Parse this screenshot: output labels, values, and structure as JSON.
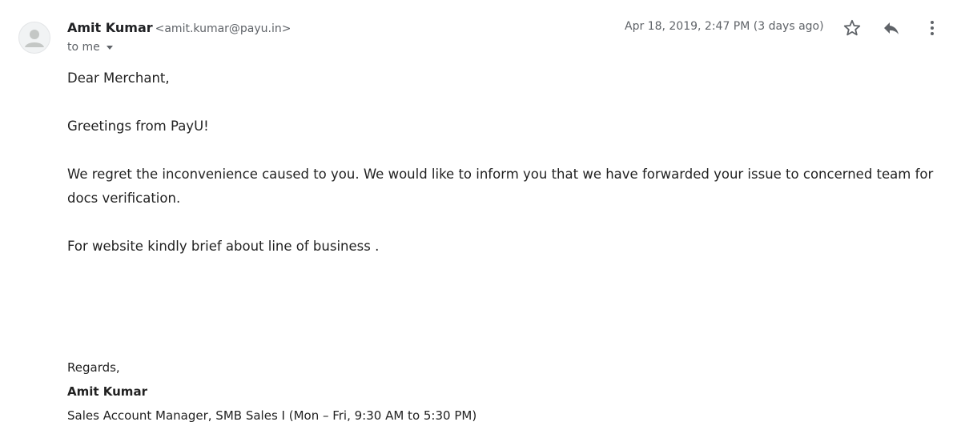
{
  "sender": {
    "name": "Amit Kumar",
    "email": "<amit.kumar@payu.in>",
    "recipient": "to me",
    "date": "Apr 18, 2019, 2:47 PM (3 days ago)"
  },
  "icons": {
    "avatar": "avatar-placeholder-icon",
    "star": "star-icon",
    "reply": "reply-icon",
    "more": "more-vertical-icon"
  },
  "body": {
    "greeting": "Dear Merchant,",
    "line1": "Greetings from PayU!",
    "para1_line1": "We regret the inconvenience caused to you. We would like to inform you that we have forwarded your issue to concerned team for",
    "para1_line2": "docs verification.",
    "line3": "For website kindly brief about line of business ."
  },
  "signature": {
    "regards": "Regards,",
    "name": "Amit Kumar",
    "title": "Sales Account Manager, SMB Sales I (Mon – Fri, 9:30 AM to 5:30 PM)"
  }
}
